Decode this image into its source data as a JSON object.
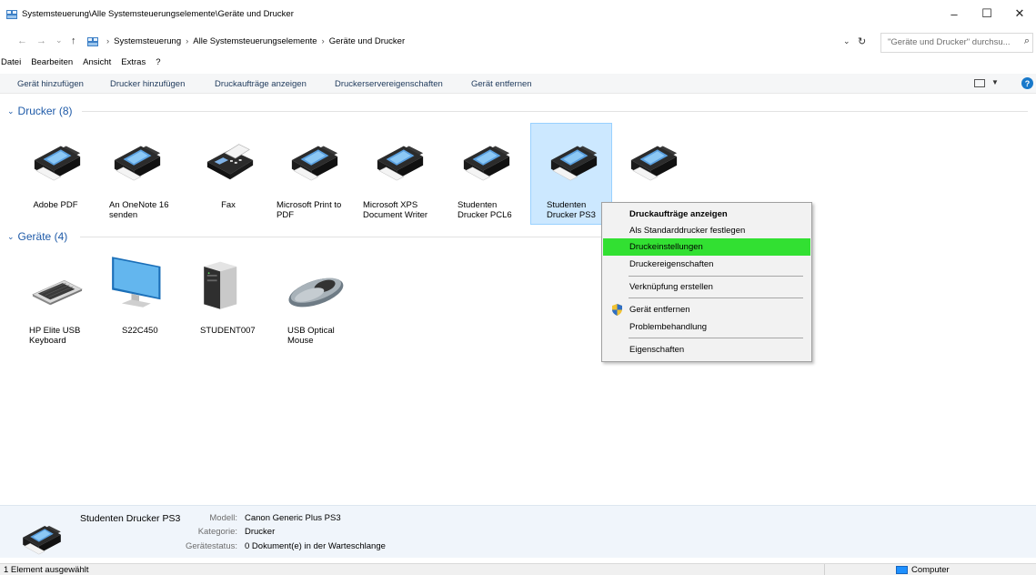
{
  "window": {
    "title": "Systemsteuerung\\Alle Systemsteuerungselemente\\Geräte und Drucker",
    "minimize": "–",
    "maximize": "☐",
    "close": "✕"
  },
  "nav": {
    "back": "←",
    "forward": "→",
    "recent": "⌄",
    "up": "↑",
    "crumbs": [
      "Systemsteuerung",
      "Alle Systemsteuerungselemente",
      "Geräte und Drucker"
    ],
    "crumb_sep": "›",
    "dropdown": "⌄",
    "refresh": "↻"
  },
  "search": {
    "placeholder": "\"Geräte und Drucker\" durchsu...",
    "icon": "⌕"
  },
  "menu": [
    "Datei",
    "Bearbeiten",
    "Ansicht",
    "Extras",
    "?"
  ],
  "commands": [
    "Gerät hinzufügen",
    "Drucker hinzufügen",
    "Druckaufträge anzeigen",
    "Druckerservereigenschaften",
    "Gerät entfernen"
  ],
  "command_extras": {
    "view_dd": "▼",
    "help": "?"
  },
  "groups": {
    "printers": {
      "chevron": "⌄",
      "title": "Drucker (8)"
    },
    "devices": {
      "chevron": "⌄",
      "title": "Geräte (4)"
    }
  },
  "printers": [
    {
      "label": "Adobe PDF",
      "icon": "printer-icon"
    },
    {
      "label": "An OneNote 16 senden",
      "icon": "printer-icon"
    },
    {
      "label": "Fax",
      "icon": "fax-icon"
    },
    {
      "label": "Microsoft Print to PDF",
      "icon": "printer-icon"
    },
    {
      "label": "Microsoft XPS Document Writer",
      "icon": "printer-icon"
    },
    {
      "label": "Studenten Drucker PCL6",
      "icon": "printer-icon"
    },
    {
      "label": "Studenten Drucker PS3",
      "icon": "printer-icon",
      "selected": true
    },
    {
      "label": "",
      "icon": "printer-icon"
    }
  ],
  "devices": [
    {
      "label": "HP Elite USB Keyboard",
      "icon": "keyboard-icon"
    },
    {
      "label": "S22C450",
      "icon": "monitor-icon"
    },
    {
      "label": "STUDENT007",
      "icon": "computer-tower-icon"
    },
    {
      "label": "USB Optical Mouse",
      "icon": "mouse-icon"
    }
  ],
  "context_menu": {
    "items": [
      {
        "label": "Druckaufträge anzeigen",
        "bold": true
      },
      {
        "label": "Als Standarddrucker festlegen"
      },
      {
        "label": "Druckeinstellungen",
        "highlighted": true
      },
      {
        "label": "Druckereigenschaften"
      },
      {
        "label": "Verknüpfung erstellen"
      },
      {
        "label": "Gerät entfernen",
        "icon": "shield-icon"
      },
      {
        "label": "Problembehandlung"
      },
      {
        "label": "Eigenschaften"
      }
    ]
  },
  "details": {
    "name": "Studenten Drucker PS3",
    "model_key": "Modell:",
    "model_val": "Canon Generic Plus PS3",
    "category_key": "Kategorie:",
    "category_val": "Drucker",
    "status_key": "Gerätestatus:",
    "status_val": "0 Dokument(e) in der Warteschlange"
  },
  "statusbar": {
    "left": "1 Element ausgewählt",
    "right": "Computer"
  },
  "colors": {
    "accent": "#1e5aa8",
    "selection": "#cce8ff",
    "menu_highlight": "#32e032"
  }
}
